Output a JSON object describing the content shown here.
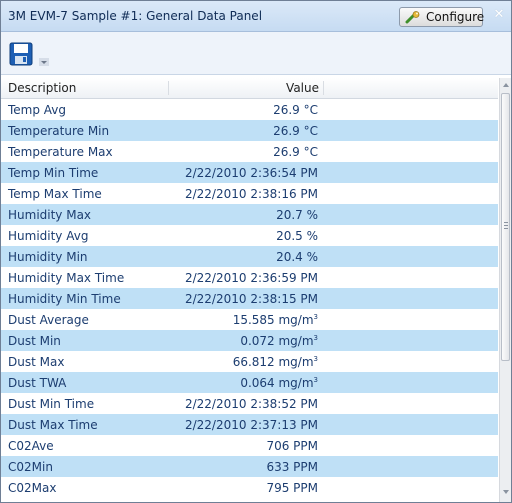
{
  "window": {
    "title": "3M EVM-7 Sample #1: General Data Panel",
    "configure_label": "Configure",
    "close_glyph": "✕"
  },
  "toolbar": {
    "save_icon": "floppy-disk-icon",
    "dropdown_icon": "chevron-down-icon"
  },
  "grid": {
    "columns": [
      "Description",
      "Value"
    ],
    "rows": [
      {
        "desc": "Temp Avg",
        "val": "26.9 °C"
      },
      {
        "desc": "Temperature Min",
        "val": "26.9 °C"
      },
      {
        "desc": "Temperature Max",
        "val": "26.9 °C"
      },
      {
        "desc": "Temp Min Time",
        "val": "2/22/2010 2:36:54 PM"
      },
      {
        "desc": "Temp Max Time",
        "val": "2/22/2010 2:38:16 PM"
      },
      {
        "desc": "Humidity Max",
        "val": "20.7 %"
      },
      {
        "desc": "Humidity Avg",
        "val": "20.5 %"
      },
      {
        "desc": "Humidity Min",
        "val": "20.4 %"
      },
      {
        "desc": "Humidity Max Time",
        "val": "2/22/2010 2:36:59 PM"
      },
      {
        "desc": "Humidity Min Time",
        "val": "2/22/2010 2:38:15 PM"
      },
      {
        "desc": "Dust Average",
        "val": "15.585 mg/m",
        "sup": "3"
      },
      {
        "desc": "Dust Min",
        "val": "0.072 mg/m",
        "sup": "3"
      },
      {
        "desc": "Dust Max",
        "val": "66.812 mg/m",
        "sup": "3"
      },
      {
        "desc": "Dust TWA",
        "val": "0.064 mg/m",
        "sup": "3"
      },
      {
        "desc": "Dust Min Time",
        "val": "2/22/2010 2:38:52 PM"
      },
      {
        "desc": "Dust Max Time",
        "val": "2/22/2010 2:37:13 PM"
      },
      {
        "desc": "C02Ave",
        "val": "706 PPM"
      },
      {
        "desc": "C02Min",
        "val": "633 PPM"
      },
      {
        "desc": "C02Max",
        "val": "795 PPM"
      }
    ]
  },
  "colors": {
    "row_alt": "#bfe0f6",
    "title_bar": "#c6dbf2",
    "text": "#1c3d70"
  }
}
